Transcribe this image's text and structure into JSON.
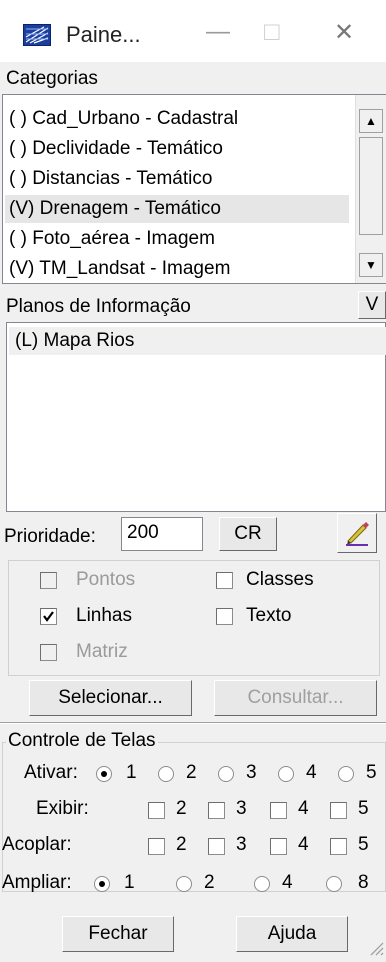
{
  "window": {
    "title": "Paine...",
    "minimize": "—",
    "maximize": "□",
    "close": "✕"
  },
  "categorias": {
    "label": "Categorias",
    "items": [
      "( ) Cad_Urbano - Cadastral",
      "( ) Declividade - Temático",
      "( ) Distancias - Temático",
      "(V) Drenagem - Temático",
      "( ) Foto_aérea - Imagem",
      "(V) TM_Landsat - Imagem"
    ],
    "selected_index": 3
  },
  "planos": {
    "label": "Planos de Informação",
    "v_button": "V",
    "items": [
      "(L) Mapa Rios"
    ]
  },
  "prioridade": {
    "label": "Prioridade:",
    "value": "200",
    "cr_button": "CR"
  },
  "options": {
    "pontos": "Pontos",
    "linhas": "Linhas",
    "matriz": "Matriz",
    "classes": "Classes",
    "texto": "Texto"
  },
  "actions": {
    "selecionar": "Selecionar...",
    "consultar": "Consultar..."
  },
  "controle": {
    "title": "Controle de Telas",
    "ativar_label": "Ativar:",
    "exibir_label": "Exibir:",
    "acoplar_label": "Acoplar:",
    "ampliar_label": "Ampliar:",
    "n1": "1",
    "n2": "2",
    "n3": "3",
    "n4": "4",
    "n5": "5",
    "n8": "8"
  },
  "footer": {
    "fechar": "Fechar",
    "ajuda": "Ajuda"
  },
  "icons": {
    "app": "map-grid-icon",
    "pencil": "pencil-icon"
  }
}
